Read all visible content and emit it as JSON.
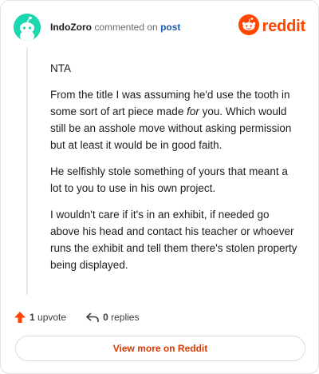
{
  "header": {
    "username": "IndoZoro",
    "action": "commented on",
    "post_link": "post",
    "logo_text": "reddit"
  },
  "comment": {
    "paragraphs": [
      "NTA",
      "From the title I was assuming he'd use the tooth in some sort of art piece made ",
      "He selfishly stole something of yours that meant a lot to you to use in his own project.",
      "I wouldn't care if it's in an exhibit, if needed go above his head and contact his teacher or whoever runs the exhibit and tell them there's stolen property being displayed."
    ],
    "p2_em": "for",
    "p2_tail": " you. Which would still be an asshole move without asking permission but at least it would be in good faith."
  },
  "footer": {
    "upvote_count": "1",
    "upvote_label": "upvote",
    "reply_count": "0",
    "reply_label": "replies",
    "view_more": "View more on Reddit"
  },
  "colors": {
    "brand": "#ff4500",
    "link": "#1a5cae",
    "avatar": "#1ad7b0"
  },
  "icons": [
    "snoo-avatar-icon",
    "reddit-logo-icon",
    "upvote-icon",
    "reply-icon"
  ]
}
